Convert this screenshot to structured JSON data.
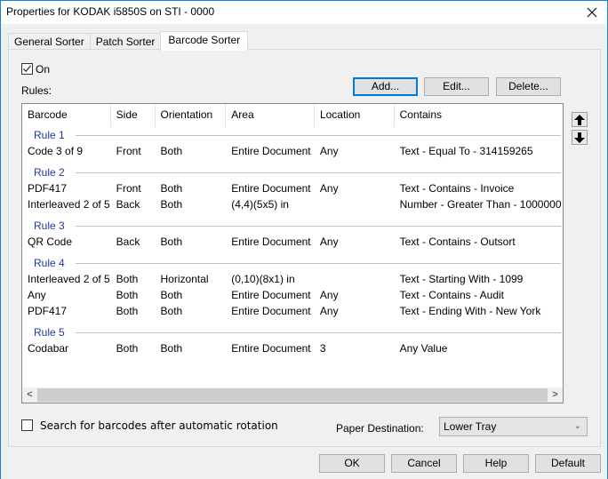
{
  "window": {
    "title": "Properties for KODAK i5850S on STI - 0000",
    "close_icon": "close-x-icon"
  },
  "tabs": [
    {
      "label": "General Sorter",
      "active": false
    },
    {
      "label": "Patch Sorter",
      "active": false
    },
    {
      "label": "Barcode Sorter",
      "active": true
    }
  ],
  "panel": {
    "on_checkbox": {
      "label": "On",
      "checked": true
    },
    "rules_label": "Rules:",
    "buttons": {
      "add": "Add...",
      "edit": "Edit...",
      "delete": "Delete..."
    },
    "move_up_icon": "arrow-up-icon",
    "move_down_icon": "arrow-down-icon"
  },
  "rules_table": {
    "columns": [
      "Barcode",
      "Side",
      "Orientation",
      "Area",
      "Location",
      "Contains"
    ],
    "groups": [
      {
        "label": "Rule 1",
        "rows": [
          [
            "Code 3 of 9",
            "Front",
            "Both",
            "Entire Document",
            "Any",
            "Text - Equal To - 314159265"
          ]
        ]
      },
      {
        "label": "Rule 2",
        "rows": [
          [
            "PDF417",
            "Front",
            "Both",
            "Entire Document",
            "Any",
            "Text - Contains - Invoice"
          ],
          [
            "Interleaved 2 of 5",
            "Back",
            "Both",
            "(4,4)(5x5) in",
            "",
            "Number - Greater Than - 1000000"
          ]
        ]
      },
      {
        "label": "Rule 3",
        "rows": [
          [
            "QR Code",
            "Back",
            "Both",
            "Entire Document",
            "Any",
            "Text - Contains - Outsort"
          ]
        ]
      },
      {
        "label": "Rule 4",
        "rows": [
          [
            "Interleaved 2 of 5",
            "Both",
            "Horizontal",
            "(0,10)(8x1) in",
            "",
            "Text - Starting With - 1099"
          ],
          [
            "Any",
            "Both",
            "Both",
            "Entire Document",
            "Any",
            "Text - Contains - Audit"
          ],
          [
            "PDF417",
            "Both",
            "Both",
            "Entire Document",
            "Any",
            "Text - Ending With - New York"
          ]
        ]
      },
      {
        "label": "Rule 5",
        "rows": [
          [
            "Codabar",
            "Both",
            "Both",
            "Entire Document",
            "3",
            "Any Value"
          ]
        ]
      }
    ],
    "scroll_left": "<",
    "scroll_right": ">"
  },
  "options": {
    "rotation_checkbox": {
      "label": "Search for barcodes after automatic rotation",
      "checked": false
    },
    "paper_destination_label": "Paper Destination:",
    "paper_destination_value": "Lower Tray"
  },
  "footer": {
    "ok": "OK",
    "cancel": "Cancel",
    "help": "Help",
    "default": "Default"
  },
  "colors": {
    "accent": "#0078d7",
    "rule_header": "#1e3a9b",
    "window_border": "#1a7fd9"
  }
}
